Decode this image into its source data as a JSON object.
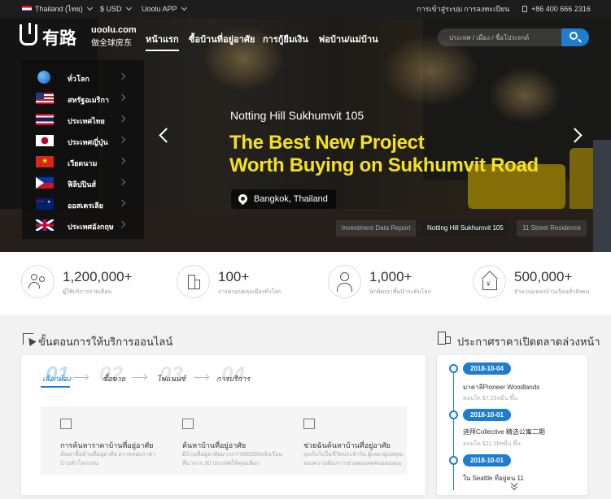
{
  "topbar": {
    "region": "Thailand (ไทย)",
    "currency": "$ USD",
    "app": "Uoolu APP",
    "login": "การเข้าสู่ระบบ",
    "divider": "|",
    "register": "การลงทะเบียน",
    "phone": "+86 400 666 2316"
  },
  "logo": {
    "cn": "有路",
    "domain": "uoolu.com",
    "sub": "做全球房东"
  },
  "nav": [
    "หน้าแรก",
    "ซื้อบ้านที่อยู่อาศัย",
    "การกู้ยืมเงิน",
    "พ่อบ้าน/แม่บ้าน"
  ],
  "search": {
    "placeholder": "ประเทศ / เมือง / ชื่อโปรเจกต์"
  },
  "countries": [
    {
      "label": "ทั่วโลก",
      "flag": "globe"
    },
    {
      "label": "สหรัฐอเมริกา",
      "flag": "us"
    },
    {
      "label": "ประเทศไทย",
      "flag": "th"
    },
    {
      "label": "ประเทศญี่ปุ่น",
      "flag": "jp"
    },
    {
      "label": "เวียดนาม",
      "flag": "vn"
    },
    {
      "label": "ฟิลิปปินส์",
      "flag": "ph"
    },
    {
      "label": "ออสเตรเลีย",
      "flag": "au"
    },
    {
      "label": "ประเทศอังกฤษ",
      "flag": "gb"
    }
  ],
  "slide": {
    "subtitle": "Notting Hill Sukhumvit 105",
    "title1": "The Best New Project",
    "title2": "Worth Buying on Sukhumvit Road",
    "location": "Bangkok, Thailand"
  },
  "thumbs": [
    "Investment Data Report",
    "Notting Hill Sukhumvit 105",
    "11 Street Residence"
  ],
  "stats": [
    {
      "num": "1,200,000+",
      "cap": "ผู้ใช้บริการรายเดือน",
      "icon": "users-icon"
    },
    {
      "num": "100+",
      "cap": "การครอบคลุมเมืองทั่วโลก",
      "icon": "building-icon"
    },
    {
      "num": "1,000+",
      "cap": "นักพัฒนาชั้นนำระดับโลก",
      "icon": "person-tie-icon"
    },
    {
      "num": "500,000+",
      "cap": "จำนวนแหล่งบ้านเรือนทั่วสังคม",
      "icon": "house-yen-icon"
    }
  ],
  "process": {
    "title": "ขั้นตอนการให้บริการออนไลน์",
    "steps": [
      {
        "num": "01",
        "label": "เลือกห้อง"
      },
      {
        "num": "02",
        "label": "ซื้อขาย"
      },
      {
        "num": "03",
        "label": "ไฟแนนซ์"
      },
      {
        "num": "04",
        "label": "การบริการ"
      }
    ],
    "services": [
      {
        "title": "การค้นหาราคาบ้านที่อยู่อาศัย",
        "desc": "ค้นหาซื้อบ้านที่อยู่อาศัย ตรวจสอบราคาบ้านทั่วโลกก่อน"
      },
      {
        "title": "ค้นหาบ้านที่อยู่อาศัย",
        "desc": "มีบ้านที่อยู่อาศัยมากกว่า500000หลังเรือนที่มาจาก 30 ประเทศให้คุณเลือก"
      },
      {
        "title": "ช่วยฉันค้นหาบ้านที่อยู่อาศัย",
        "desc": "ลุงเก็บไปในชีวิตประจำวัน ผู้เหยาดูแลคุณสองความต้องการช่วยคุณคดคณเดมคุณ"
      }
    ]
  },
  "presale": {
    "title": "ประกาศราคาเปิดตลาดล่วงหน้า",
    "items": [
      {
        "date": "2018-10-04",
        "title": "มาคาลีPioneer Woodlands",
        "price": "คอนโด $7.23หมื่น ขึ้น"
      },
      {
        "date": "2018-10-01",
        "title": "迪拜Collective 精选公寓二期",
        "price": "คอนโด $21.08หมื่น ขึ้น"
      },
      {
        "date": "2018-10-01",
        "title": "ใน Seattle ที่อยู่คน 11",
        "price": ""
      }
    ]
  }
}
